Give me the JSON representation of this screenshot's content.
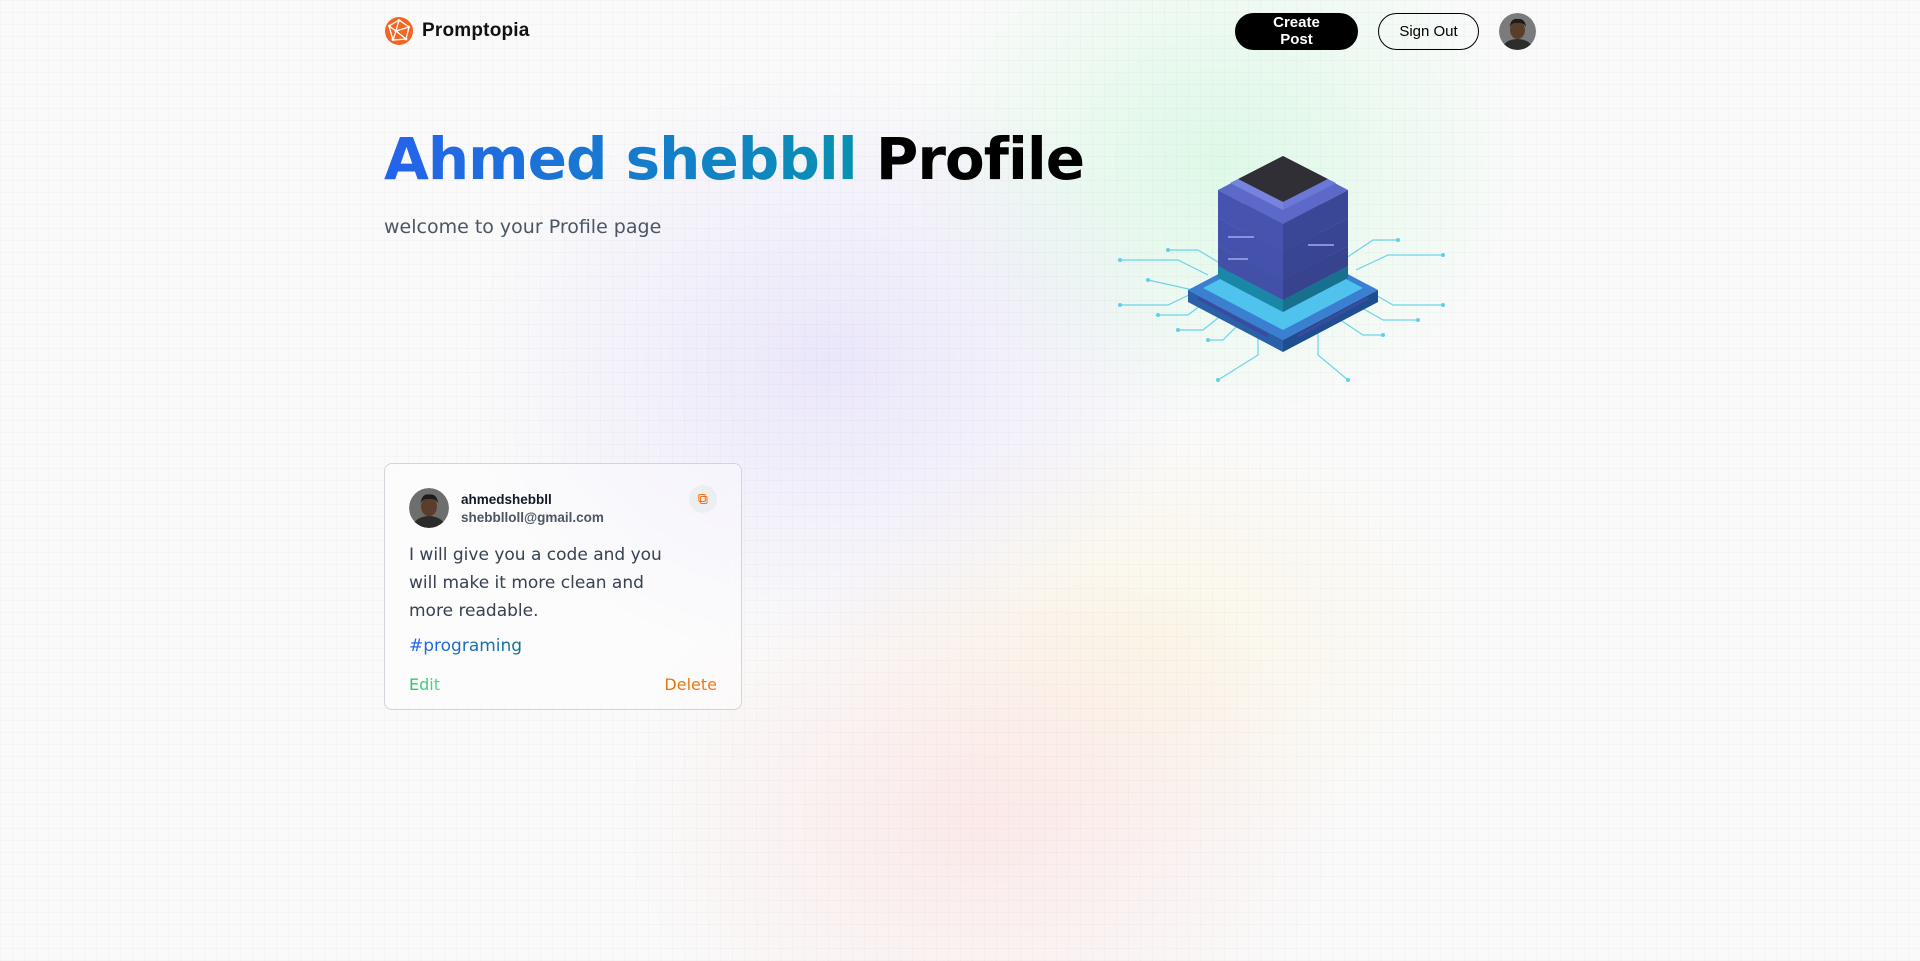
{
  "brand": {
    "name": "Promptopia",
    "logo_icon": "promptopia-logo-icon",
    "logo_color": "#f97316"
  },
  "nav": {
    "create_post_label": "Create Post",
    "sign_out_label": "Sign Out",
    "avatar_icon": "user-avatar"
  },
  "hero": {
    "name": "Ahmed shebbll",
    "suffix": "Profile",
    "description": "welcome to your Profile page",
    "illustration_icon": "server-chip-illustration",
    "name_gradient": [
      "#2563eb",
      "#0891b2"
    ]
  },
  "posts": [
    {
      "username": "ahmedshebbll",
      "email": "shebblloll@gmail.com",
      "prompt": "I will give you a code and you will make it more clean and more readable.",
      "tag": "#programing",
      "copy_icon": "copy-icon",
      "edit_label": "Edit",
      "delete_label": "Delete"
    }
  ],
  "colors": {
    "edit": "#22c55e",
    "delete": "#f97316",
    "tag": "#2563eb"
  }
}
